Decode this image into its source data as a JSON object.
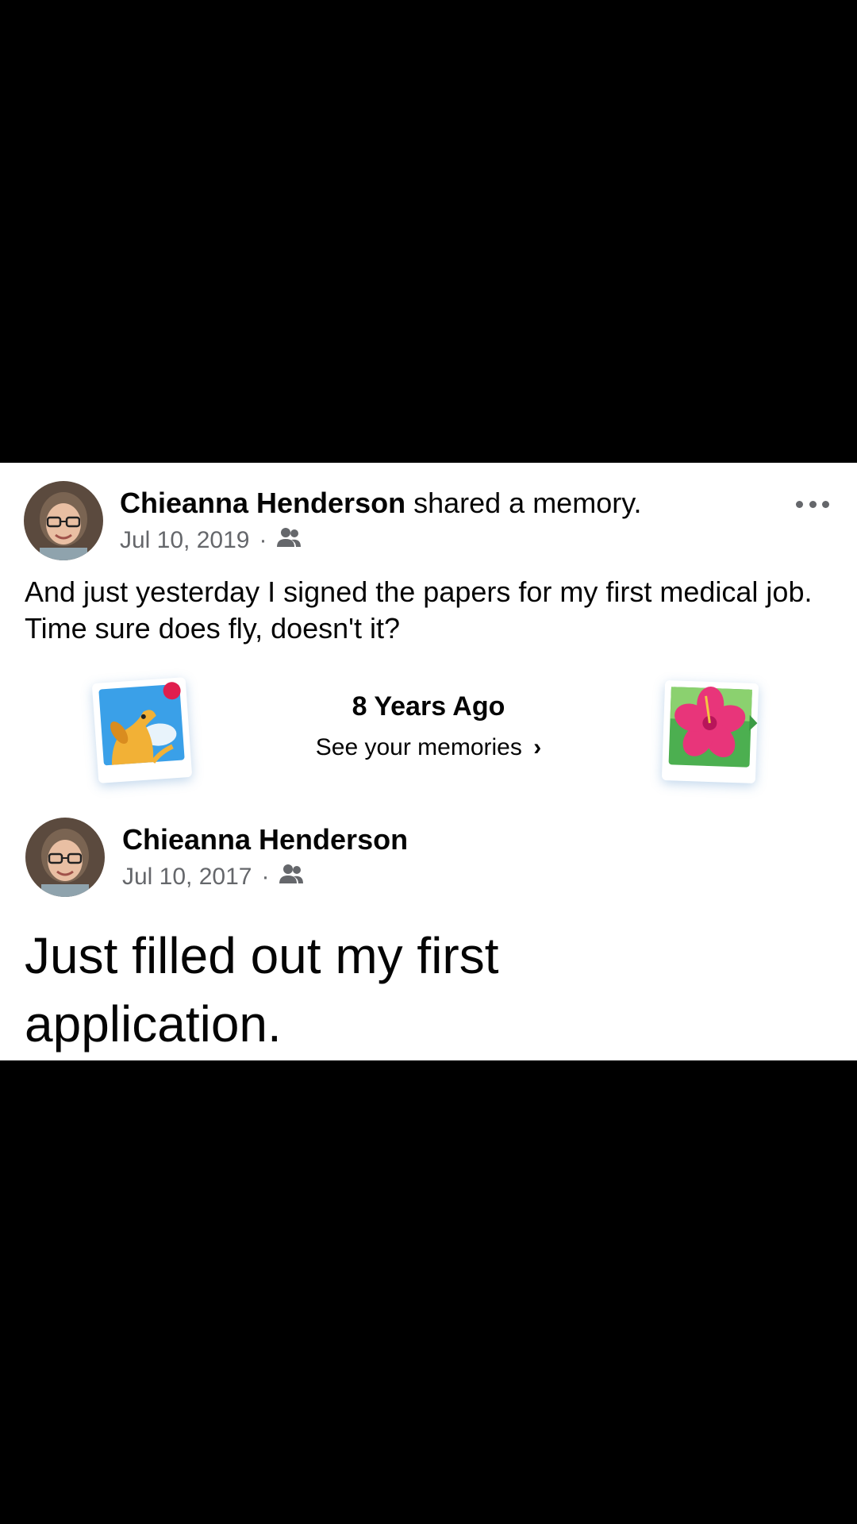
{
  "post": {
    "author": "Chieanna Henderson",
    "action": "shared a memory.",
    "date": "Jul 10, 2019",
    "separator": "·",
    "audience_icon": "friends-icon",
    "more_icon": "more-options-icon",
    "text": "And just yesterday I signed the papers for my first medical job. Time sure does fly, doesn't it?"
  },
  "memories": {
    "title": "8 Years Ago",
    "link_label": "See your memories",
    "chevron": "›",
    "left_art": "dog-polaroid-icon",
    "right_art": "flower-polaroid-icon"
  },
  "shared_post": {
    "author": "Chieanna Henderson",
    "date": "Jul 10, 2017",
    "separator": "·",
    "audience_icon": "friends-icon",
    "text": "Just filled out my first application."
  },
  "colors": {
    "background": "#000000",
    "card": "#ffffff",
    "primary_text": "#050505",
    "secondary_text": "#65676b"
  }
}
